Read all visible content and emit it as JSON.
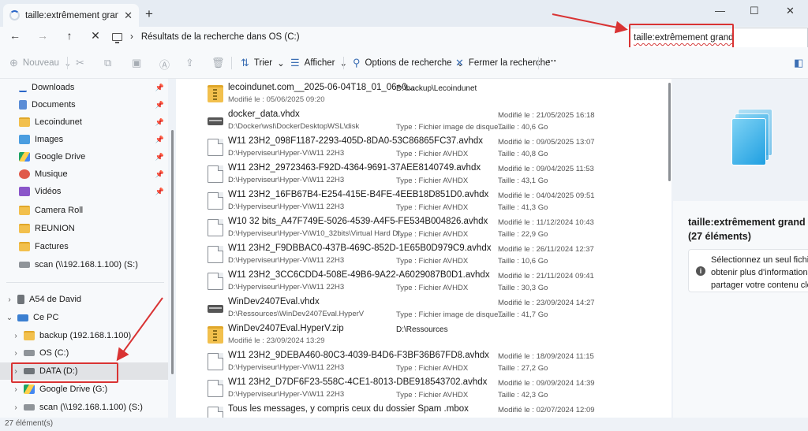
{
  "tab": {
    "title": "taille:extrêmement grand - Rés",
    "close": "✕",
    "new_tab": "+"
  },
  "window_controls": {
    "minimize": "—",
    "maximize": "☐",
    "close": "✕"
  },
  "nav": {
    "back": "←",
    "forward": "→",
    "up": "↑",
    "stop": "✕",
    "chevron": "›",
    "breadcrumb": "Résultats de la recherche dans OS (C:)"
  },
  "search": {
    "value": "taille:extrêmement grand"
  },
  "toolbar": {
    "new": "Nouveau",
    "sort": "Trier",
    "view": "Afficher",
    "search_options": "Options de recherche",
    "close_search": "Fermer la recherche",
    "more": "···"
  },
  "sidebar": {
    "quick": [
      {
        "label": "Downloads",
        "icon": "download-icon"
      },
      {
        "label": "Documents",
        "icon": "documents-icon"
      },
      {
        "label": "Lecoindunet",
        "icon": "folder-icon"
      },
      {
        "label": "Images",
        "icon": "images-icon"
      },
      {
        "label": "Google Drive",
        "icon": "google-drive-icon"
      },
      {
        "label": "Musique",
        "icon": "music-icon"
      },
      {
        "label": "Vidéos",
        "icon": "videos-icon"
      },
      {
        "label": "Camera Roll",
        "icon": "folder-icon"
      },
      {
        "label": "REUNION",
        "icon": "folder-icon"
      },
      {
        "label": "Factures",
        "icon": "folder-icon"
      },
      {
        "label": "scan (\\\\192.168.1.100) (S:)",
        "icon": "network-drive-icon"
      }
    ],
    "tree": [
      {
        "label": "A54 de David",
        "icon": "phone-icon"
      },
      {
        "label": "Ce PC",
        "icon": "pc-icon"
      },
      {
        "label": "backup (192.168.1.100)",
        "icon": "folder-icon"
      },
      {
        "label": "OS (C:)",
        "icon": "drive-icon"
      },
      {
        "label": "DATA (D:)",
        "icon": "drive-icon"
      },
      {
        "label": "Google Drive (G:)",
        "icon": "google-drive-icon"
      },
      {
        "label": "scan (\\\\192.168.1.100) (S:)",
        "icon": "network-drive-icon"
      }
    ]
  },
  "files": [
    {
      "name": "lecoindunet.com__2025-06-04T18_01_06+0...",
      "sub": "Modifié le : 05/06/2025 09:20",
      "location": "D:\\backup\\Lecoindunet",
      "type": "",
      "modified": "",
      "size": "",
      "icon": "zip"
    },
    {
      "name": "docker_data.vhdx",
      "sub": "D:\\Docker\\wsl\\DockerDesktopWSL\\disk",
      "location": "",
      "type": "Type : Fichier image de disque...",
      "modified": "Modifié le : 21/05/2025 16:18",
      "size": "Taille : 40,6 Go",
      "icon": "disk"
    },
    {
      "name": "W11 23H2_098F1187-2293-405D-8DA0-53C86865FC37.avhdx",
      "sub": "D:\\Hyperviseur\\Hyper-V\\W11 22H3",
      "location": "",
      "type": "Type : Fichier AVHDX",
      "modified": "Modifié le : 09/05/2025 13:07",
      "size": "Taille : 40,8 Go",
      "icon": "doc"
    },
    {
      "name": "W11 23H2_29723463-F92D-4364-9691-37AEE8140749.avhdx",
      "sub": "D:\\Hyperviseur\\Hyper-V\\W11 22H3",
      "location": "",
      "type": "Type : Fichier AVHDX",
      "modified": "Modifié le : 09/04/2025 11:53",
      "size": "Taille : 43,1 Go",
      "icon": "doc"
    },
    {
      "name": "W11 23H2_16FB67B4-E254-415E-B4FE-4EEB18D851D0.avhdx",
      "sub": "D:\\Hyperviseur\\Hyper-V\\W11 22H3",
      "location": "",
      "type": "Type : Fichier AVHDX",
      "modified": "Modifié le : 04/04/2025 09:51",
      "size": "Taille : 41,3 Go",
      "icon": "doc"
    },
    {
      "name": "W10 32 bits_A47F749E-5026-4539-A4F5-FE534B004826.avhdx",
      "sub": "D:\\Hyperviseur\\Hyper-V\\W10_32bits\\Virtual Hard Di...",
      "location": "",
      "type": "Type : Fichier AVHDX",
      "modified": "Modifié le : 11/12/2024 10:43",
      "size": "Taille : 22,9 Go",
      "icon": "doc"
    },
    {
      "name": "W11 23H2_F9DBBAC0-437B-469C-852D-1E65B0D979C9.avhdx",
      "sub": "D:\\Hyperviseur\\Hyper-V\\W11 22H3",
      "location": "",
      "type": "Type : Fichier AVHDX",
      "modified": "Modifié le : 26/11/2024 12:37",
      "size": "Taille : 10,6 Go",
      "icon": "doc"
    },
    {
      "name": "W11 23H2_3CC6CDD4-508E-49B6-9A22-A6029087B0D1.avhdx",
      "sub": "D:\\Hyperviseur\\Hyper-V\\W11 22H3",
      "location": "",
      "type": "Type : Fichier AVHDX",
      "modified": "Modifié le : 21/11/2024 09:41",
      "size": "Taille : 30,3 Go",
      "icon": "doc"
    },
    {
      "name": "WinDev2407Eval.vhdx",
      "sub": "D:\\Ressources\\WinDev2407Eval.HyperV",
      "location": "",
      "type": "Type : Fichier image de disque...",
      "modified": "Modifié le : 23/09/2024 14:27",
      "size": "Taille : 41,7 Go",
      "icon": "disk"
    },
    {
      "name": "WinDev2407Eval.HyperV.zip",
      "sub": "Modifié le : 23/09/2024 13:29",
      "location": "D:\\Ressources",
      "type": "",
      "modified": "",
      "size": "",
      "icon": "zip"
    },
    {
      "name": "W11 23H2_9DEBA460-80C3-4039-B4D6-F3BF36B67FD8.avhdx",
      "sub": "D:\\Hyperviseur\\Hyper-V\\W11 22H3",
      "location": "",
      "type": "Type : Fichier AVHDX",
      "modified": "Modifié le : 18/09/2024 11:15",
      "size": "Taille : 27,2 Go",
      "icon": "doc"
    },
    {
      "name": "W11 23H2_D7DF6F23-558C-4CE1-8013-DBE918543702.avhdx",
      "sub": "D:\\Hyperviseur\\Hyper-V\\W11 22H3",
      "location": "",
      "type": "Type : Fichier AVHDX",
      "modified": "Modifié le : 09/09/2024 14:39",
      "size": "Taille : 42,3 Go",
      "icon": "doc"
    },
    {
      "name": "Tous les messages, y compris ceux du dossier Spam .mbox",
      "sub": "",
      "location": "",
      "type": "",
      "modified": "Modifié le : 02/07/2024 12:09",
      "size": "",
      "icon": "doc"
    }
  ],
  "details": {
    "title": "taille:extrêmement grand (27 éléments)",
    "info_lines": [
      "Sélectionnez un seul fichier p",
      "obtenir plus d'informations e",
      "partager votre contenu cloud"
    ]
  },
  "status": {
    "count": "27 élément(s)"
  },
  "colors": {
    "accent": "#2a66c8",
    "annotation": "#d93333",
    "folder": "#f2c04d"
  }
}
